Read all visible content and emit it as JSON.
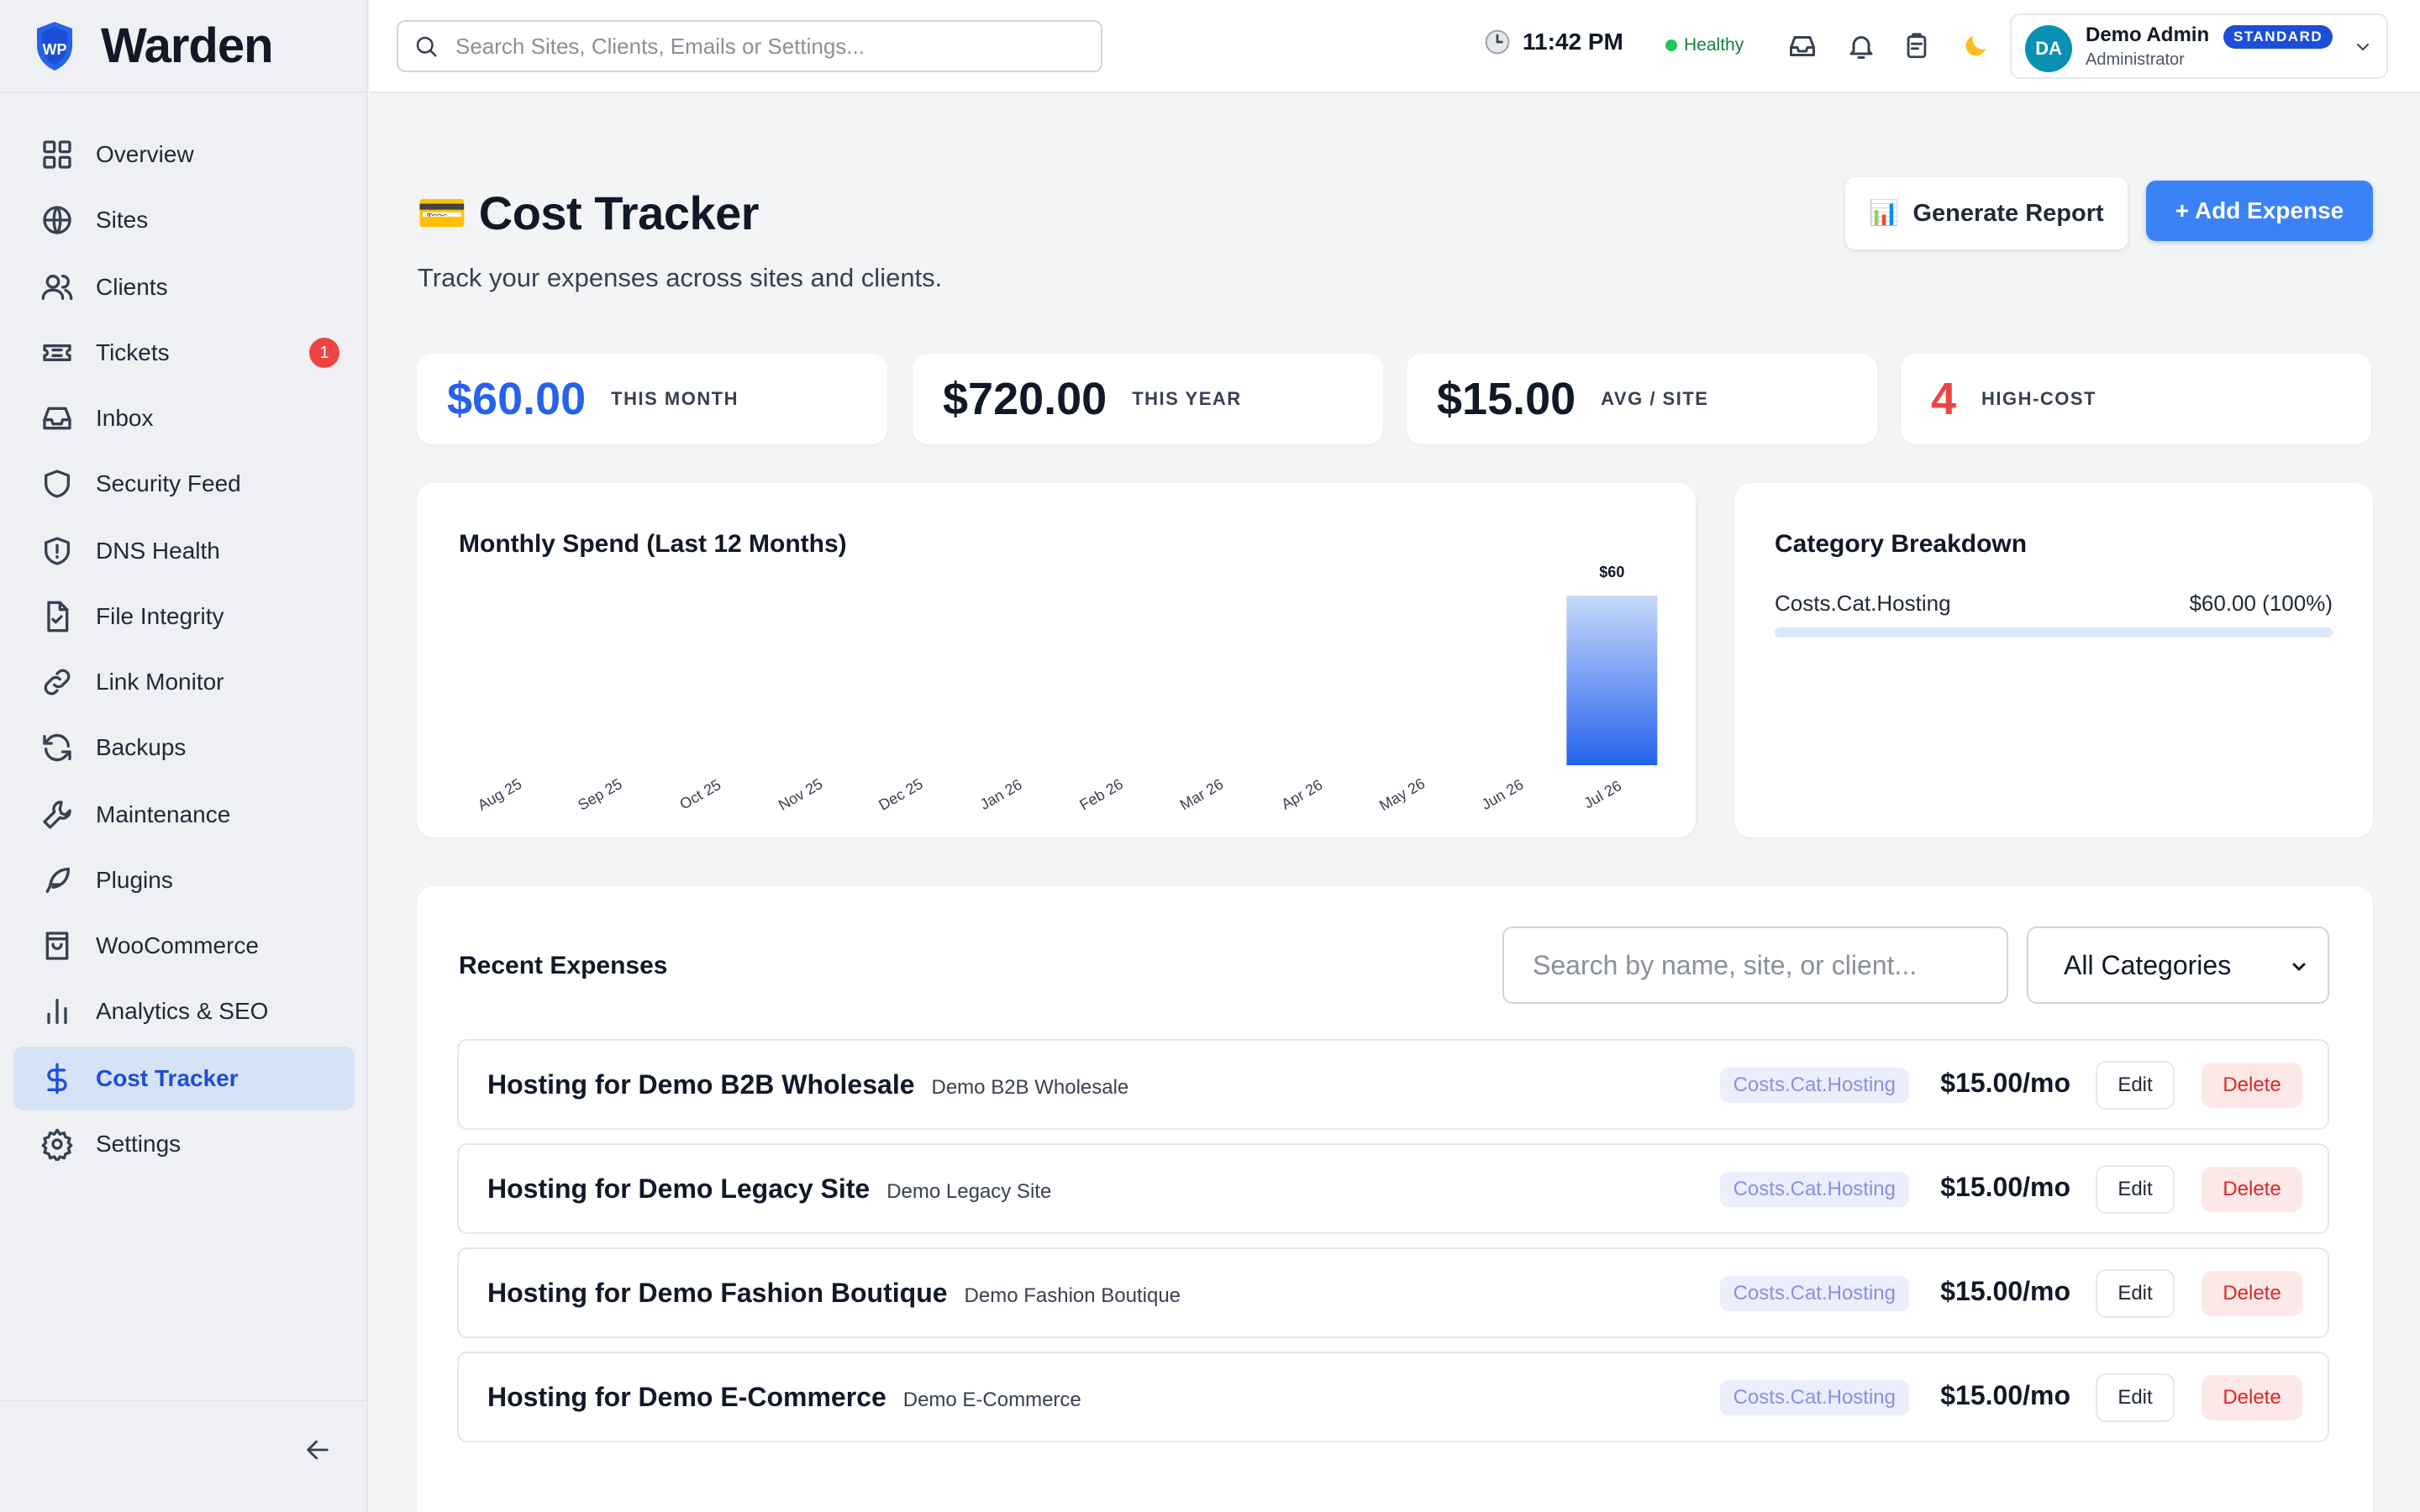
{
  "app": {
    "name": "Warden",
    "logo_text": "WP"
  },
  "sidebar": {
    "items": [
      {
        "label": "Overview",
        "icon": "grid-icon"
      },
      {
        "label": "Sites",
        "icon": "globe-icon"
      },
      {
        "label": "Clients",
        "icon": "users-icon"
      },
      {
        "label": "Tickets",
        "icon": "ticket-icon",
        "badge": "1"
      },
      {
        "label": "Inbox",
        "icon": "inbox-icon"
      },
      {
        "label": "Security Feed",
        "icon": "shield-icon"
      },
      {
        "label": "DNS Health",
        "icon": "shield-alert-icon"
      },
      {
        "label": "File Integrity",
        "icon": "file-check-icon"
      },
      {
        "label": "Link Monitor",
        "icon": "link-icon"
      },
      {
        "label": "Backups",
        "icon": "refresh-icon"
      },
      {
        "label": "Maintenance",
        "icon": "wrench-icon"
      },
      {
        "label": "Plugins",
        "icon": "feather-icon"
      },
      {
        "label": "WooCommerce",
        "icon": "shopping-bag-icon"
      },
      {
        "label": "Analytics & SEO",
        "icon": "bar-chart-icon"
      },
      {
        "label": "Cost Tracker",
        "icon": "dollar-icon",
        "active": true
      },
      {
        "label": "Settings",
        "icon": "gear-icon"
      }
    ]
  },
  "topbar": {
    "search_placeholder": "Search Sites, Clients, Emails or Settings...",
    "time": "11:42 PM",
    "health": "Healthy",
    "user": {
      "initials": "DA",
      "name": "Demo Admin",
      "role": "Administrator",
      "plan": "STANDARD"
    }
  },
  "page": {
    "icon": "💳",
    "title": "Cost Tracker",
    "subtitle": "Track your expenses across sites and clients.",
    "report_label": "Generate Report",
    "report_icon": "📊",
    "add_label": "+ Add Expense"
  },
  "stats": [
    {
      "value": "$60.00",
      "label": "THIS MONTH",
      "color": "#2563eb"
    },
    {
      "value": "$720.00",
      "label": "THIS YEAR",
      "color": "#111827"
    },
    {
      "value": "$15.00",
      "label": "AVG / SITE",
      "color": "#111827"
    },
    {
      "value": "4",
      "label": "HIGH-COST",
      "color": "#ef4444"
    }
  ],
  "chart_data": {
    "type": "bar",
    "title": "Monthly Spend (Last 12 Months)",
    "categories": [
      "Aug 25",
      "Sep 25",
      "Oct 25",
      "Nov 25",
      "Dec 25",
      "Jan 26",
      "Feb 26",
      "Mar 26",
      "Apr 26",
      "May 26",
      "Jun 26",
      "Jul 26"
    ],
    "values": [
      0,
      0,
      0,
      0,
      0,
      0,
      0,
      0,
      0,
      0,
      0,
      60
    ],
    "data_labels": [
      "",
      "",
      "",
      "",
      "",
      "",
      "",
      "",
      "",
      "",
      "",
      "$60"
    ],
    "grid": false,
    "bar_color_top": "#c7d9fb",
    "bar_color_bottom": "#2563eb"
  },
  "category_breakdown": {
    "title": "Category Breakdown",
    "items": [
      {
        "name": "Costs.Cat.Hosting",
        "value": "$60.00 (100%)",
        "fraction": 1.0
      }
    ]
  },
  "expenses": {
    "title": "Recent Expenses",
    "search_placeholder": "Search by name, site, or client...",
    "filter_selected": "All Categories",
    "edit_label": "Edit",
    "delete_label": "Delete",
    "rows": [
      {
        "name": "Hosting for Demo B2B Wholesale",
        "client": "Demo B2B Wholesale",
        "category": "Costs.Cat.Hosting",
        "amount": "$15.00/mo"
      },
      {
        "name": "Hosting for Demo Legacy Site",
        "client": "Demo Legacy Site",
        "category": "Costs.Cat.Hosting",
        "amount": "$15.00/mo"
      },
      {
        "name": "Hosting for Demo Fashion Boutique",
        "client": "Demo Fashion Boutique",
        "category": "Costs.Cat.Hosting",
        "amount": "$15.00/mo"
      },
      {
        "name": "Hosting for Demo E-Commerce",
        "client": "Demo E-Commerce",
        "category": "Costs.Cat.Hosting",
        "amount": "$15.00/mo"
      }
    ]
  }
}
